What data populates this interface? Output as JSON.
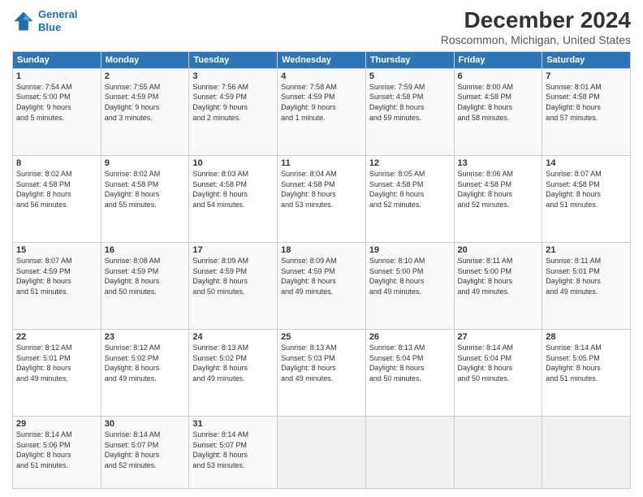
{
  "logo": {
    "line1": "General",
    "line2": "Blue"
  },
  "title": "December 2024",
  "subtitle": "Roscommon, Michigan, United States",
  "days_of_week": [
    "Sunday",
    "Monday",
    "Tuesday",
    "Wednesday",
    "Thursday",
    "Friday",
    "Saturday"
  ],
  "weeks": [
    [
      {
        "day": "1",
        "info": "Sunrise: 7:54 AM\nSunset: 5:00 PM\nDaylight: 9 hours\nand 5 minutes."
      },
      {
        "day": "2",
        "info": "Sunrise: 7:55 AM\nSunset: 4:59 PM\nDaylight: 9 hours\nand 3 minutes."
      },
      {
        "day": "3",
        "info": "Sunrise: 7:56 AM\nSunset: 4:59 PM\nDaylight: 9 hours\nand 2 minutes."
      },
      {
        "day": "4",
        "info": "Sunrise: 7:58 AM\nSunset: 4:59 PM\nDaylight: 9 hours\nand 1 minute."
      },
      {
        "day": "5",
        "info": "Sunrise: 7:59 AM\nSunset: 4:58 PM\nDaylight: 8 hours\nand 59 minutes."
      },
      {
        "day": "6",
        "info": "Sunrise: 8:00 AM\nSunset: 4:58 PM\nDaylight: 8 hours\nand 58 minutes."
      },
      {
        "day": "7",
        "info": "Sunrise: 8:01 AM\nSunset: 4:58 PM\nDaylight: 8 hours\nand 57 minutes."
      }
    ],
    [
      {
        "day": "8",
        "info": "Sunrise: 8:02 AM\nSunset: 4:58 PM\nDaylight: 8 hours\nand 56 minutes."
      },
      {
        "day": "9",
        "info": "Sunrise: 8:02 AM\nSunset: 4:58 PM\nDaylight: 8 hours\nand 55 minutes."
      },
      {
        "day": "10",
        "info": "Sunrise: 8:03 AM\nSunset: 4:58 PM\nDaylight: 8 hours\nand 54 minutes."
      },
      {
        "day": "11",
        "info": "Sunrise: 8:04 AM\nSunset: 4:58 PM\nDaylight: 8 hours\nand 53 minutes."
      },
      {
        "day": "12",
        "info": "Sunrise: 8:05 AM\nSunset: 4:58 PM\nDaylight: 8 hours\nand 52 minutes."
      },
      {
        "day": "13",
        "info": "Sunrise: 8:06 AM\nSunset: 4:58 PM\nDaylight: 8 hours\nand 52 minutes."
      },
      {
        "day": "14",
        "info": "Sunrise: 8:07 AM\nSunset: 4:58 PM\nDaylight: 8 hours\nand 51 minutes."
      }
    ],
    [
      {
        "day": "15",
        "info": "Sunrise: 8:07 AM\nSunset: 4:59 PM\nDaylight: 8 hours\nand 51 minutes."
      },
      {
        "day": "16",
        "info": "Sunrise: 8:08 AM\nSunset: 4:59 PM\nDaylight: 8 hours\nand 50 minutes."
      },
      {
        "day": "17",
        "info": "Sunrise: 8:09 AM\nSunset: 4:59 PM\nDaylight: 8 hours\nand 50 minutes."
      },
      {
        "day": "18",
        "info": "Sunrise: 8:09 AM\nSunset: 4:59 PM\nDaylight: 8 hours\nand 49 minutes."
      },
      {
        "day": "19",
        "info": "Sunrise: 8:10 AM\nSunset: 5:00 PM\nDaylight: 8 hours\nand 49 minutes."
      },
      {
        "day": "20",
        "info": "Sunrise: 8:11 AM\nSunset: 5:00 PM\nDaylight: 8 hours\nand 49 minutes."
      },
      {
        "day": "21",
        "info": "Sunrise: 8:11 AM\nSunset: 5:01 PM\nDaylight: 8 hours\nand 49 minutes."
      }
    ],
    [
      {
        "day": "22",
        "info": "Sunrise: 8:12 AM\nSunset: 5:01 PM\nDaylight: 8 hours\nand 49 minutes."
      },
      {
        "day": "23",
        "info": "Sunrise: 8:12 AM\nSunset: 5:02 PM\nDaylight: 8 hours\nand 49 minutes."
      },
      {
        "day": "24",
        "info": "Sunrise: 8:13 AM\nSunset: 5:02 PM\nDaylight: 8 hours\nand 49 minutes."
      },
      {
        "day": "25",
        "info": "Sunrise: 8:13 AM\nSunset: 5:03 PM\nDaylight: 8 hours\nand 49 minutes."
      },
      {
        "day": "26",
        "info": "Sunrise: 8:13 AM\nSunset: 5:04 PM\nDaylight: 8 hours\nand 50 minutes."
      },
      {
        "day": "27",
        "info": "Sunrise: 8:14 AM\nSunset: 5:04 PM\nDaylight: 8 hours\nand 50 minutes."
      },
      {
        "day": "28",
        "info": "Sunrise: 8:14 AM\nSunset: 5:05 PM\nDaylight: 8 hours\nand 51 minutes."
      }
    ],
    [
      {
        "day": "29",
        "info": "Sunrise: 8:14 AM\nSunset: 5:06 PM\nDaylight: 8 hours\nand 51 minutes."
      },
      {
        "day": "30",
        "info": "Sunrise: 8:14 AM\nSunset: 5:07 PM\nDaylight: 8 hours\nand 52 minutes."
      },
      {
        "day": "31",
        "info": "Sunrise: 8:14 AM\nSunset: 5:07 PM\nDaylight: 8 hours\nand 53 minutes."
      },
      {
        "day": "",
        "info": ""
      },
      {
        "day": "",
        "info": ""
      },
      {
        "day": "",
        "info": ""
      },
      {
        "day": "",
        "info": ""
      }
    ]
  ]
}
